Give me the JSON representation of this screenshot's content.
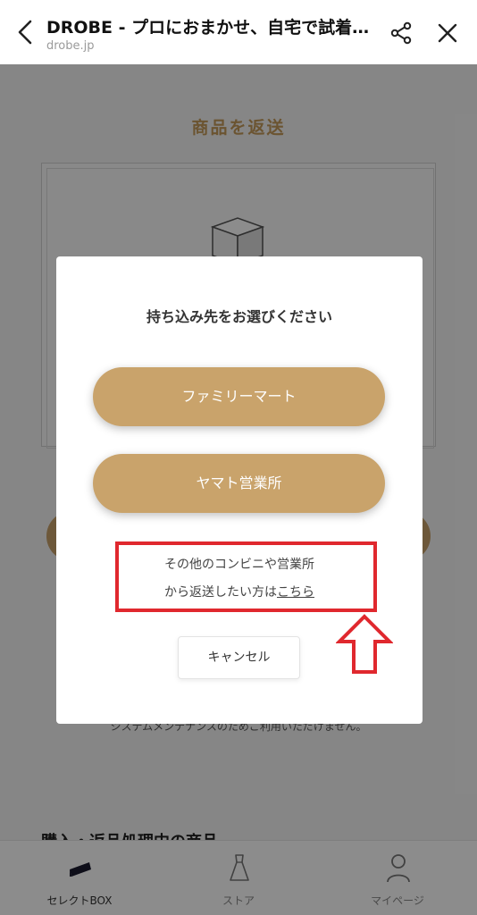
{
  "browser": {
    "title": "DROBE - プロにおまかせ、自宅で試着…",
    "url": "drobe.jp",
    "icons": {
      "back": "chevron-left-icon",
      "share": "share-icon",
      "close": "close-icon"
    }
  },
  "page": {
    "section_title": "商品を返送",
    "notice": "システムメンテナンスのためご利用いただけません。",
    "section2_title": "購入・返品処理中の商品"
  },
  "modal": {
    "title": "持ち込み先をお選びください",
    "option1": "ファミリーマート",
    "option2": "ヤマト営業所",
    "other_line1": "その他のコンビニや営業所",
    "other_line2_prefix": "から返送したい方は",
    "other_link": "こちら",
    "cancel": "キャンセル"
  },
  "bottom_nav": {
    "items": [
      {
        "label": "セレクトBOX",
        "icon": "select-box-icon"
      },
      {
        "label": "ストア",
        "icon": "dress-icon"
      },
      {
        "label": "マイページ",
        "icon": "user-icon"
      }
    ]
  },
  "colors": {
    "accent": "#c9a36b",
    "annotation_red": "#e0282e"
  }
}
